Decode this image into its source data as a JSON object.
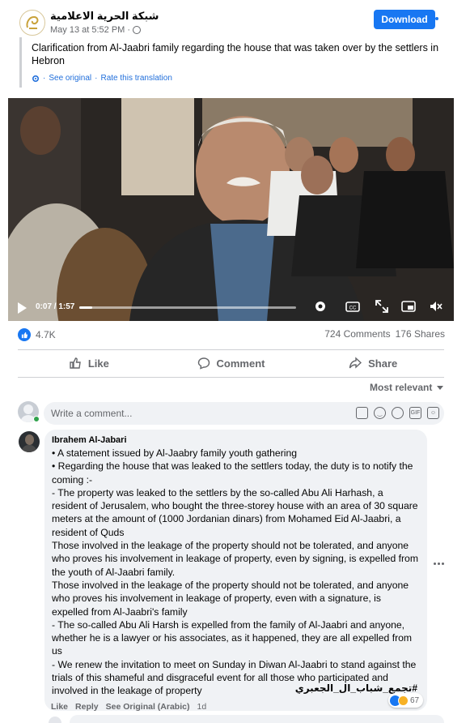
{
  "page": {
    "name": "شبكة الحرية الاعلامية",
    "post_time": "May 13 at 5:52 PM",
    "download_label": "Download",
    "brand_color": "#1877f2"
  },
  "translation": {
    "text": "Clarification from Al-Jaabri family regarding the house that was taken over by the settlers in Hebron",
    "see_original": "See original",
    "rate": "Rate this translation"
  },
  "video": {
    "time": "0:07 / 1:57",
    "progress": 0.06,
    "icons": [
      "play-icon",
      "settings-icon",
      "captions-icon",
      "fullscreen-icon",
      "picture-in-picture-icon",
      "volume-muted-icon"
    ]
  },
  "stats": {
    "reactions": "4.7K",
    "comments": "724 Comments",
    "shares": "176 Shares"
  },
  "actions": {
    "like": "Like",
    "comment": "Comment",
    "share": "Share"
  },
  "sort_label": "Most relevant",
  "composer": {
    "placeholder": "Write a comment..."
  },
  "comment": {
    "author": "Ibrahem Al-Jabari",
    "text": "• A statement issued by Al-Jaabry family youth gathering\n• Regarding the house that was leaked to the settlers today, the duty is to notify the coming :-\n- The property was leaked to the settlers by the so-called Abu Ali Harhash, a resident of Jerusalem, who bought the three-storey house with an area of 30 square meters at the amount of (1000 Jordanian dinars) from Mohamed Eid Al-Jaabri, a resident of Quds\nThose involved in the leakage of the property should not be tolerated, and anyone who proves his involvement in leakage of property, even by signing, is expelled from the youth of Al-Jaabri family.\nThose involved in the leakage of the property should not be tolerated, and anyone who proves his involvement in leakage of property, even with a signature, is expelled from Al-Jaabri's family\n- The so-called Abu Ali Harsh is expelled from the family of Al-Jaabri and anyone, whether he is a lawyer or his associates, as it happened, they are all expelled from us\n- We renew the invitation to meet on Sunday in Diwan Al-Jaabri to stand against the trials of this shameful and disgraceful event for all those who participated and involved in the leakage of property",
    "hashtag": "#تجمع_شباب_ال_الجعبري",
    "reaction_count": "67",
    "like": "Like",
    "reply": "Reply",
    "see_original": "See Original (Arabic)",
    "age": "1d"
  }
}
